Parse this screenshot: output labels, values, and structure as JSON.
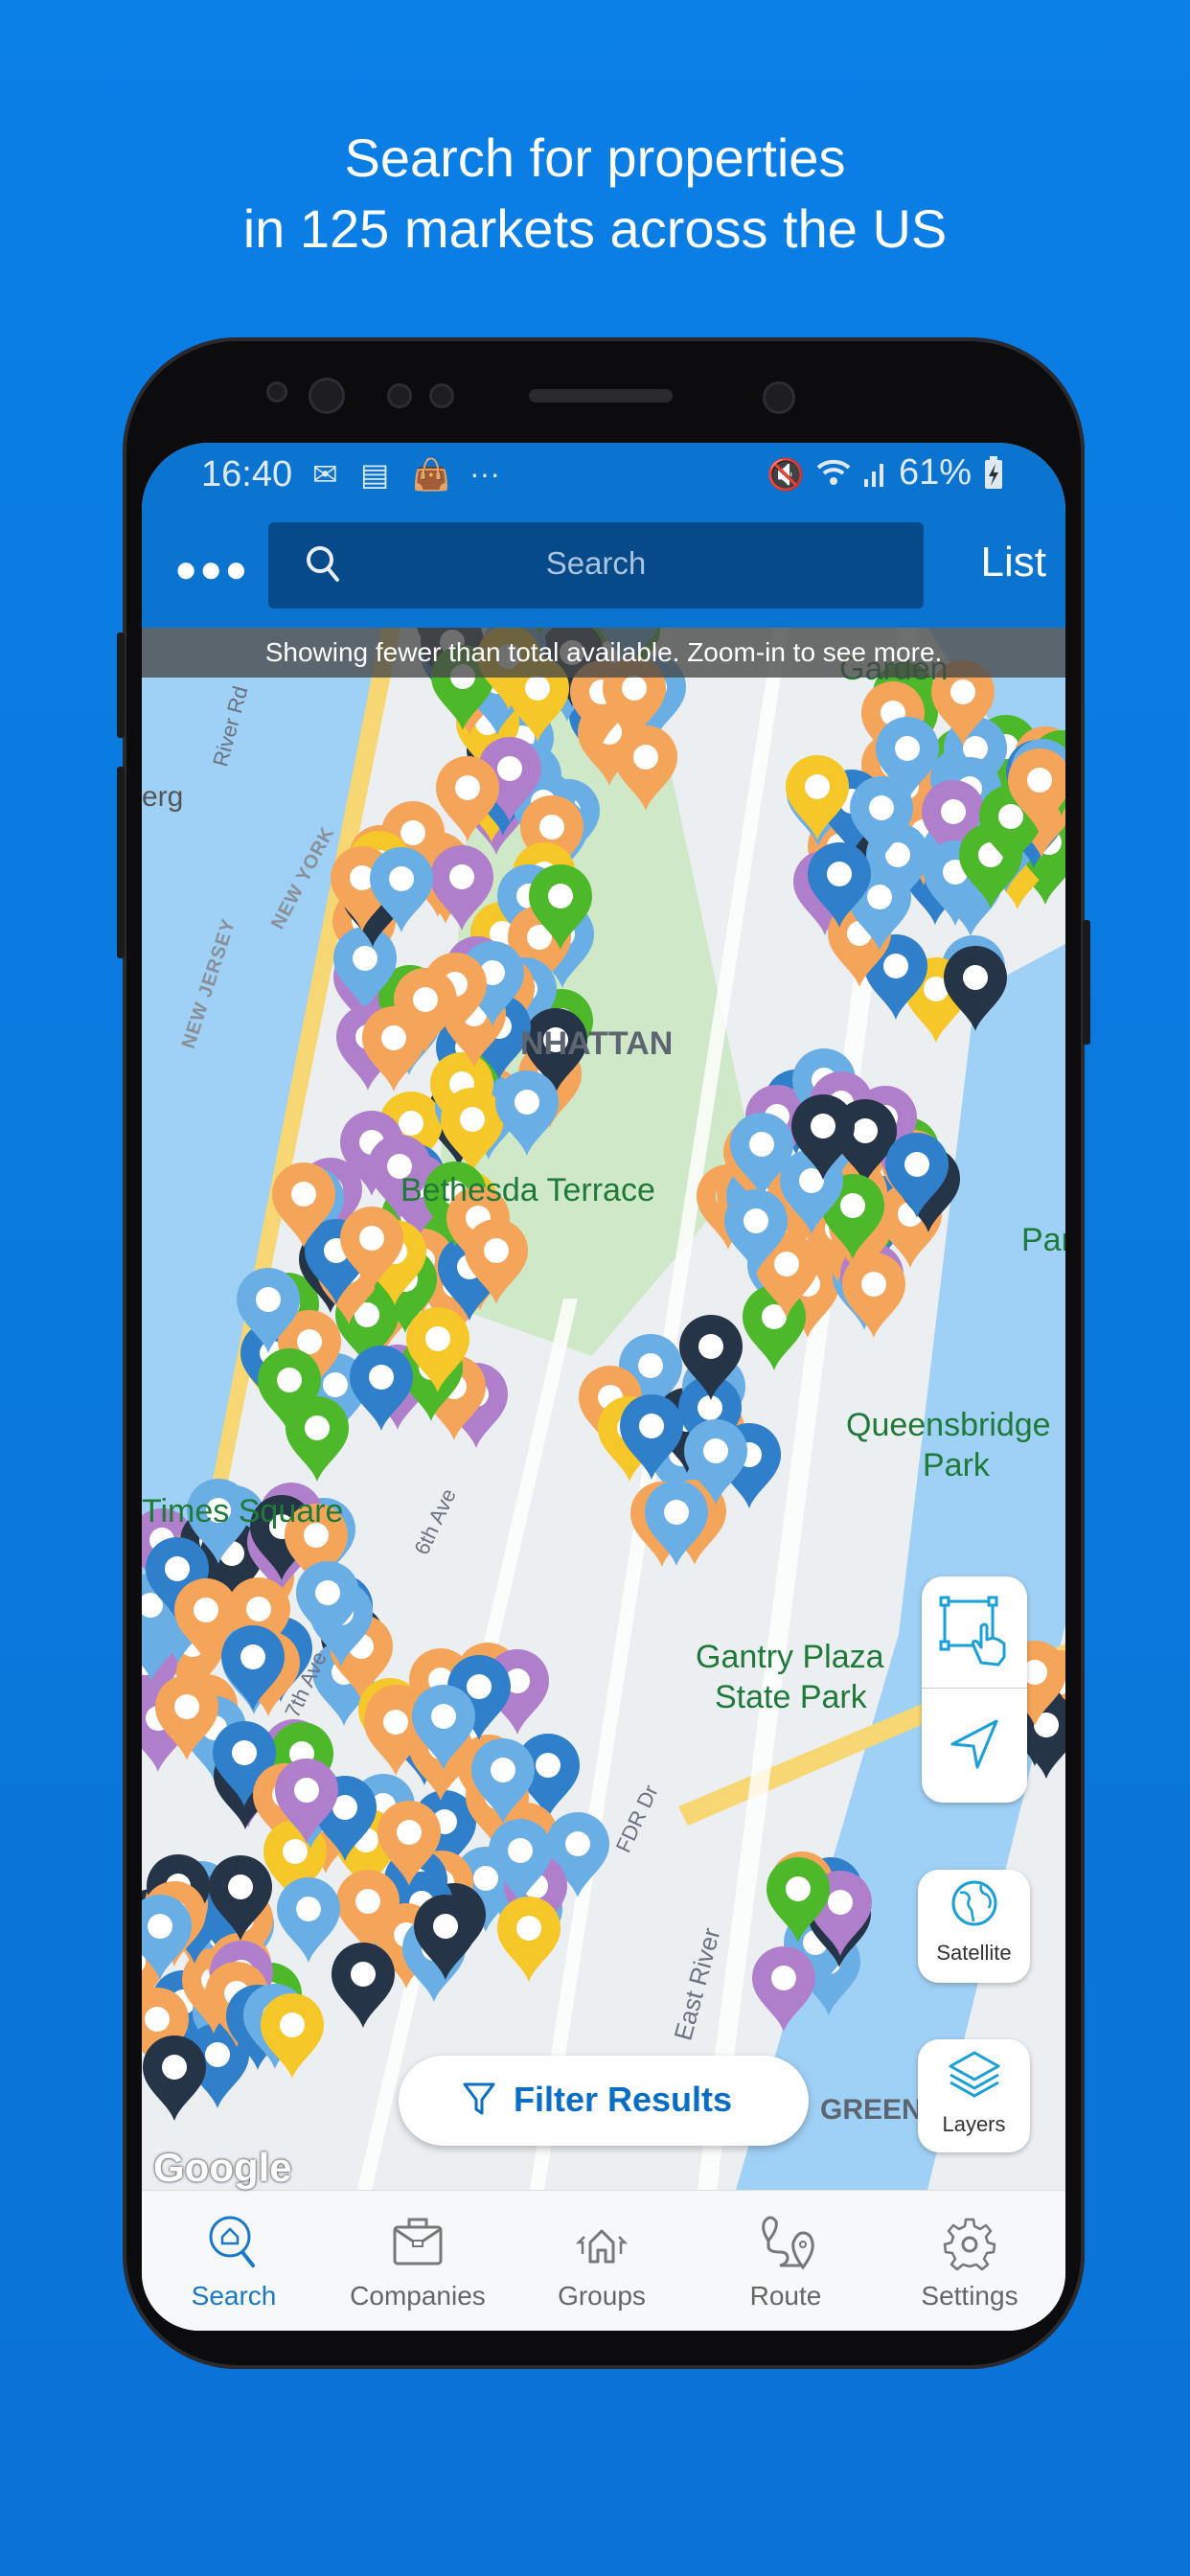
{
  "headline": {
    "line1": "Search for properties",
    "line2": "in 125 markets across the US"
  },
  "status_bar": {
    "time": "16:40",
    "battery": "61%",
    "icons_left": [
      "mail-icon",
      "calendar-icon",
      "bag-icon",
      "more-dots-icon"
    ],
    "icons_right": [
      "mute-icon",
      "wifi-icon",
      "signal-icon",
      "battery-charging-icon"
    ]
  },
  "app_bar": {
    "menu_icon": "more-dots-icon",
    "search_placeholder": "Search",
    "list_label": "List"
  },
  "banner": {
    "text": "Showing fewer than total available. Zoom-in to see more."
  },
  "map": {
    "labels": {
      "manhattan": "NHATTAN",
      "bethesda": "Bethesda Terrace",
      "queensbridge_1": "Queensbridge",
      "queensbridge_2": "Park",
      "gantry_1": "Gantry Plaza",
      "gantry_2": "State Park",
      "times_square": "Times Square",
      "garden": "Garden",
      "new_york": "NEW YORK",
      "new_jersey": "NEW JERSEY",
      "river_rd": "River Rd",
      "sixth_ave": "6th Ave",
      "seventh_ave": "7th Ave",
      "fdr": "FDR Dr",
      "east_river": "East River",
      "erg": "erg",
      "green": "GREEN",
      "park_right": "Park"
    },
    "pin_colors": {
      "orange": "#f5a55a",
      "light_blue": "#6aaee6",
      "blue": "#2f7fcb",
      "green": "#4cb82a",
      "purple": "#b07fcc",
      "dark": "#253447",
      "yellow": "#f6c728"
    },
    "google_logo": "Google"
  },
  "controls": {
    "select_area_icon": "select-area-hand-icon",
    "locate_icon": "navigation-arrow-icon",
    "satellite_label": "Satellite",
    "layers_label": "Layers"
  },
  "filter_button": {
    "label": "Filter Results"
  },
  "bottom_nav": [
    {
      "label": "Search",
      "icon": "home-search-icon",
      "active": true
    },
    {
      "label": "Companies",
      "icon": "briefcase-icon",
      "active": false
    },
    {
      "label": "Groups",
      "icon": "houses-icon",
      "active": false
    },
    {
      "label": "Route",
      "icon": "route-pins-icon",
      "active": false
    },
    {
      "label": "Settings",
      "icon": "gear-icon",
      "active": false
    }
  ],
  "accent_color": "#0a74d0"
}
